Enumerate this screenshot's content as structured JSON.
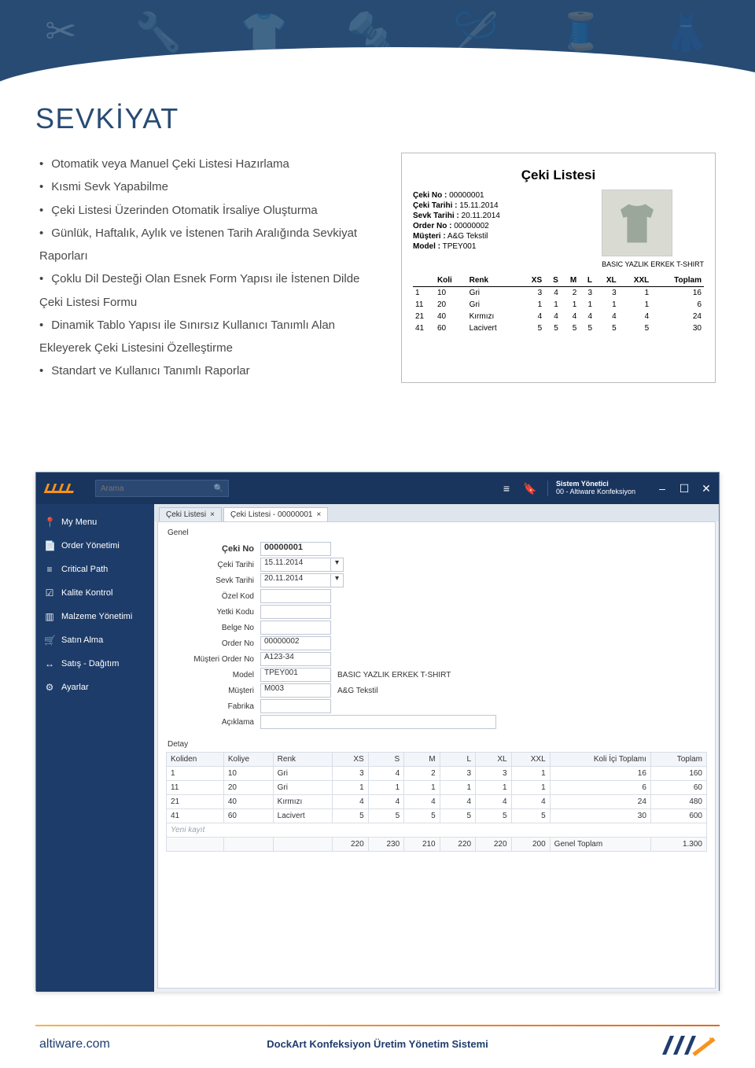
{
  "page_title": "SEVKİYAT",
  "bullets": [
    "Otomatik veya Manuel Çeki Listesi Hazırlama",
    "Kısmi Sevk Yapabilme",
    "Çeki Listesi Üzerinden Otomatik İrsaliye Oluşturma",
    "Günlük, Haftalık, Aylık ve İstenen Tarih Aralığında Sevkiyat Raporları",
    "Çoklu Dil Desteği Olan Esnek Form Yapısı ile İstenen Dilde Çeki Listesi Formu",
    "Dinamik Tablo Yapısı ile Sınırsız Kullanıcı Tanımlı Alan Ekleyerek Çeki Listesini Özelleştirme",
    "Standart ve Kullanıcı Tanımlı Raporlar"
  ],
  "report": {
    "title": "Çeki Listesi",
    "meta": {
      "ceki_no_label": "Çeki No :",
      "ceki_no": "00000001",
      "ceki_tarihi_label": "Çeki Tarihi :",
      "ceki_tarihi": "15.11.2014",
      "sevk_tarihi_label": "Sevk Tarihi :",
      "sevk_tarihi": "20.11.2014",
      "order_no_label": "Order No :",
      "order_no": "00000002",
      "musteri_label": "Müşteri :",
      "musteri": "A&G Tekstil",
      "model_label": "Model :",
      "model": "TPEY001",
      "model_desc": "BASIC YAZLIK ERKEK T-SHIRT"
    },
    "cols": [
      "",
      "Koli",
      "Renk",
      "XS",
      "S",
      "M",
      "L",
      "XL",
      "XXL",
      "Toplam"
    ],
    "rows": [
      {
        "no": "1",
        "koli": "10",
        "renk": "Gri",
        "xs": "3",
        "s": "4",
        "m": "2",
        "l": "3",
        "xl": "3",
        "xxl": "1",
        "toplam": "16"
      },
      {
        "no": "11",
        "koli": "20",
        "renk": "Gri",
        "xs": "1",
        "s": "1",
        "m": "1",
        "l": "1",
        "xl": "1",
        "xxl": "1",
        "toplam": "6"
      },
      {
        "no": "21",
        "koli": "40",
        "renk": "Kırmızı",
        "xs": "4",
        "s": "4",
        "m": "4",
        "l": "4",
        "xl": "4",
        "xxl": "4",
        "toplam": "24"
      },
      {
        "no": "41",
        "koli": "60",
        "renk": "Lacivert",
        "xs": "5",
        "s": "5",
        "m": "5",
        "l": "5",
        "xl": "5",
        "xxl": "5",
        "toplam": "30"
      }
    ]
  },
  "app": {
    "search_placeholder": "Arama",
    "user_line1": "Sistem Yönetici",
    "user_line2": "00 - Altiware Konfeksiyon",
    "sidebar": [
      {
        "icon": "📍",
        "label": "My Menu"
      },
      {
        "icon": "📄",
        "label": "Order Yönetimi"
      },
      {
        "icon": "≡",
        "label": "Critical Path"
      },
      {
        "icon": "☑",
        "label": "Kalite Kontrol"
      },
      {
        "icon": "▥",
        "label": "Malzeme Yönetimi"
      },
      {
        "icon": "🛒",
        "label": "Satın Alma"
      },
      {
        "icon": "↔",
        "label": "Satış - Dağıtım"
      },
      {
        "icon": "⚙",
        "label": "Ayarlar"
      }
    ],
    "tabs": [
      {
        "label": "Çeki Listesi",
        "close": "×"
      },
      {
        "label": "Çeki Listesi - 00000001",
        "close": "×"
      }
    ],
    "section": "Genel",
    "form": {
      "ceki_no": {
        "label": "Çeki No",
        "value": "00000001"
      },
      "ceki_tarihi": {
        "label": "Çeki Tarihi",
        "value": "15.11.2014"
      },
      "sevk_tarihi": {
        "label": "Sevk Tarihi",
        "value": "20.11.2014"
      },
      "ozel_kod": {
        "label": "Özel Kod",
        "value": ""
      },
      "yetki_kodu": {
        "label": "Yetki Kodu",
        "value": ""
      },
      "belge_no": {
        "label": "Belge No",
        "value": ""
      },
      "order_no": {
        "label": "Order No",
        "value": "00000002"
      },
      "musteri_order_no": {
        "label": "Müşteri Order No",
        "value": "A123-34"
      },
      "model": {
        "label": "Model",
        "value": "TPEY001",
        "desc": "BASIC YAZLIK ERKEK T-SHIRT"
      },
      "musteri": {
        "label": "Müşteri",
        "value": "M003",
        "desc": "A&G Tekstil"
      },
      "fabrika": {
        "label": "Fabrika",
        "value": ""
      },
      "aciklama": {
        "label": "Açıklama",
        "value": ""
      }
    },
    "detay_label": "Detay",
    "grid": {
      "cols": [
        "Koliden",
        "Koliye",
        "Renk",
        "XS",
        "S",
        "M",
        "L",
        "XL",
        "XXL",
        "Koli İçi Toplamı",
        "Toplam"
      ],
      "rows": [
        {
          "c": [
            "1",
            "10",
            "Gri",
            "3",
            "4",
            "2",
            "3",
            "3",
            "1",
            "16",
            "160"
          ]
        },
        {
          "c": [
            "11",
            "20",
            "Gri",
            "1",
            "1",
            "1",
            "1",
            "1",
            "1",
            "6",
            "60"
          ]
        },
        {
          "c": [
            "21",
            "40",
            "Kırmızı",
            "4",
            "4",
            "4",
            "4",
            "4",
            "4",
            "24",
            "480"
          ]
        },
        {
          "c": [
            "41",
            "60",
            "Lacivert",
            "5",
            "5",
            "5",
            "5",
            "5",
            "5",
            "30",
            "600"
          ]
        }
      ],
      "newrow": "Yeni kayıt",
      "footer_label": "Genel Toplam",
      "footer": [
        "",
        "",
        "",
        "220",
        "230",
        "210",
        "220",
        "220",
        "200",
        "",
        "1.300"
      ]
    }
  },
  "footer": {
    "left": "altiware.com",
    "center": "DockArt Konfeksiyon Üretim Yönetim Sistemi"
  }
}
